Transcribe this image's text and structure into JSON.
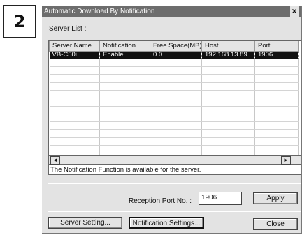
{
  "step_number": "2",
  "window": {
    "title": "Automatic Download By Notification",
    "close_label": "×"
  },
  "server_list": {
    "label": "Server List :",
    "columns": [
      "Server Name",
      "Notification",
      "Free Space(MB)",
      "Host",
      "Port"
    ],
    "rows": [
      [
        "VB-C50i",
        "Enable",
        "0.0",
        "192.168.13.89",
        "1906"
      ]
    ]
  },
  "scrollbar": {
    "left_arrow": "◄",
    "right_arrow": "►"
  },
  "status_message": "The Notification Function is available for the server.",
  "reception_port": {
    "label": "Reception Port No. :",
    "value": "1906"
  },
  "buttons": {
    "apply": "Apply",
    "server_setting": "Server Setting...",
    "notification_settings": "Notification Settings...",
    "close": "Close"
  }
}
